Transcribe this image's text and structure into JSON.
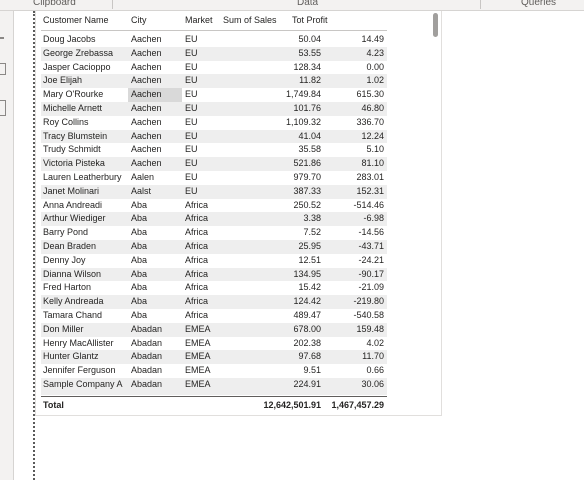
{
  "ribbon": {
    "groups": [
      "Clipboard",
      "Data",
      "Queries"
    ]
  },
  "table": {
    "columns": [
      "Customer Name",
      "City",
      "Market",
      "Sum of Sales",
      "Tot Profit"
    ],
    "rows": [
      [
        "Doug Jacobs",
        "Aachen",
        "EU",
        "50.04",
        "14.49"
      ],
      [
        "George Zrebassa",
        "Aachen",
        "EU",
        "53.55",
        "4.23"
      ],
      [
        "Jasper Cacioppo",
        "Aachen",
        "EU",
        "128.34",
        "0.00"
      ],
      [
        "Joe Elijah",
        "Aachen",
        "EU",
        "11.82",
        "1.02"
      ],
      [
        "Mary O'Rourke",
        "Aachen",
        "EU",
        "1,749.84",
        "615.30"
      ],
      [
        "Michelle Arnett",
        "Aachen",
        "EU",
        "101.76",
        "46.80"
      ],
      [
        "Roy Collins",
        "Aachen",
        "EU",
        "1,109.32",
        "336.70"
      ],
      [
        "Tracy Blumstein",
        "Aachen",
        "EU",
        "41.04",
        "12.24"
      ],
      [
        "Trudy Schmidt",
        "Aachen",
        "EU",
        "35.58",
        "5.10"
      ],
      [
        "Victoria Pisteka",
        "Aachen",
        "EU",
        "521.86",
        "81.10"
      ],
      [
        "Lauren Leatherbury",
        "Aalen",
        "EU",
        "979.70",
        "283.01"
      ],
      [
        "Janet Molinari",
        "Aalst",
        "EU",
        "387.33",
        "152.31"
      ],
      [
        "Anna Andreadi",
        "Aba",
        "Africa",
        "250.52",
        "-514.46"
      ],
      [
        "Arthur Wiediger",
        "Aba",
        "Africa",
        "3.38",
        "-6.98"
      ],
      [
        "Barry Pond",
        "Aba",
        "Africa",
        "7.52",
        "-14.56"
      ],
      [
        "Dean Braden",
        "Aba",
        "Africa",
        "25.95",
        "-43.71"
      ],
      [
        "Denny Joy",
        "Aba",
        "Africa",
        "12.51",
        "-24.21"
      ],
      [
        "Dianna Wilson",
        "Aba",
        "Africa",
        "134.95",
        "-90.17"
      ],
      [
        "Fred Harton",
        "Aba",
        "Africa",
        "15.42",
        "-21.09"
      ],
      [
        "Kelly Andreada",
        "Aba",
        "Africa",
        "124.42",
        "-219.80"
      ],
      [
        "Tamara Chand",
        "Aba",
        "Africa",
        "489.47",
        "-540.58"
      ],
      [
        "Don Miller",
        "Abadan",
        "EMEA",
        "678.00",
        "159.48"
      ],
      [
        "Henry MacAllister",
        "Abadan",
        "EMEA",
        "202.38",
        "4.02"
      ],
      [
        "Hunter Glantz",
        "Abadan",
        "EMEA",
        "97.68",
        "11.70"
      ],
      [
        "Jennifer Ferguson",
        "Abadan",
        "EMEA",
        "9.51",
        "0.66"
      ],
      [
        "Sample Company A",
        "Abadan",
        "EMEA",
        "224.91",
        "30.06"
      ]
    ],
    "total": {
      "label": "Total",
      "sales": "12,642,501.91",
      "profit": "1,467,457.29"
    }
  }
}
